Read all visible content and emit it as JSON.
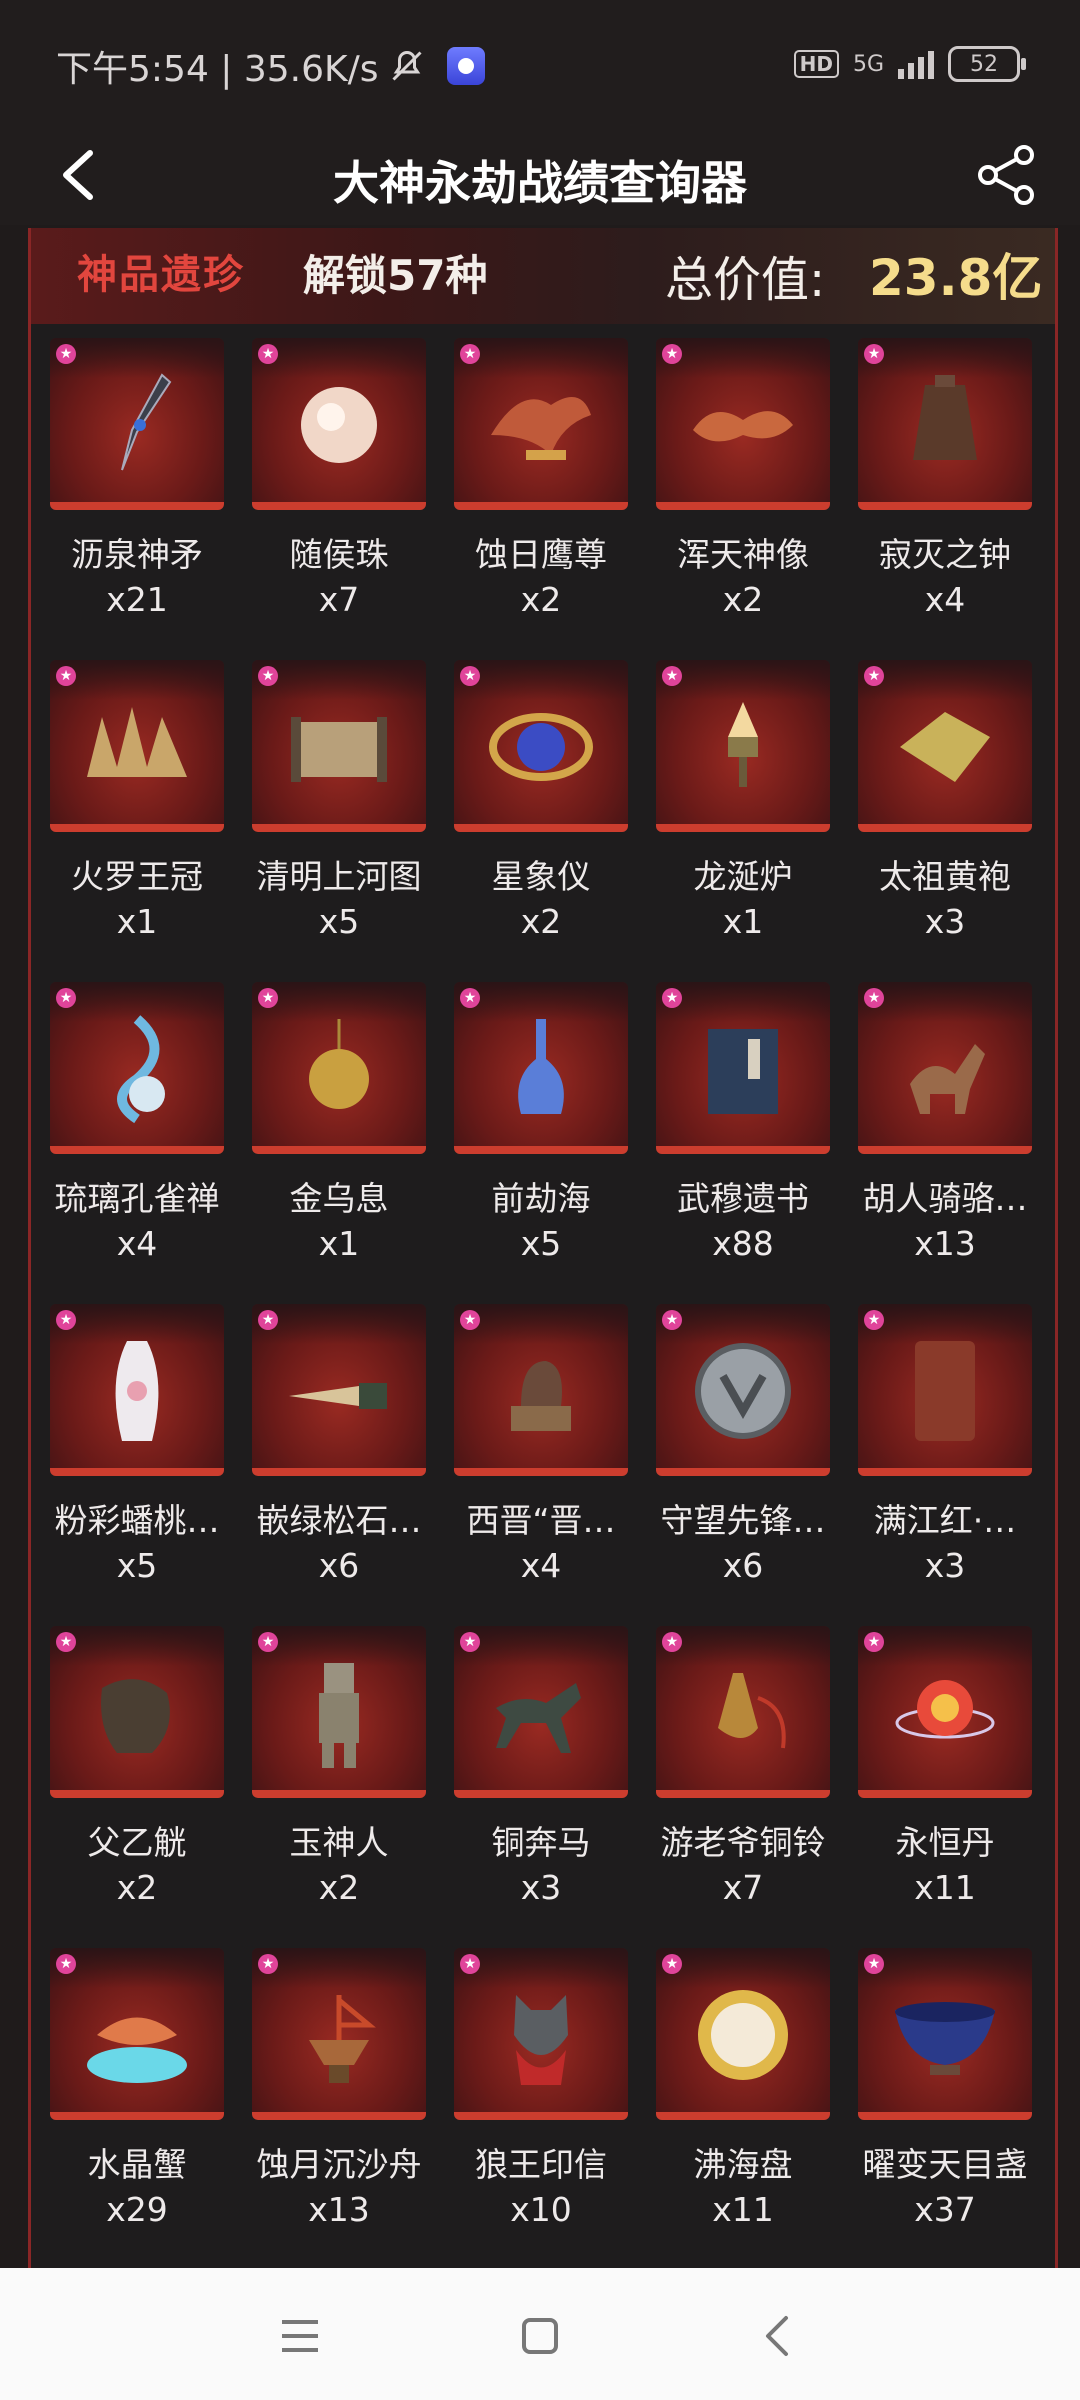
{
  "status_bar": {
    "time_speed": "下午5:54 | 35.6K/s",
    "network_hd": "HD",
    "network_gen": "5G",
    "battery": "52"
  },
  "header": {
    "title": "大神永劫战绩查询器"
  },
  "panel": {
    "tier_label": "神品遗珍",
    "unlock_text": "解锁57种",
    "total_label": "总价值:",
    "total_value": "23.8亿"
  },
  "items": [
    {
      "name": "沥泉神矛",
      "count": "x21",
      "icon": "spear-icon"
    },
    {
      "name": "随侯珠",
      "count": "x7",
      "icon": "pearl-icon"
    },
    {
      "name": "蚀日鹰尊",
      "count": "x2",
      "icon": "eagle-vessel-icon"
    },
    {
      "name": "浑天神像",
      "count": "x2",
      "icon": "dragon-statue-icon"
    },
    {
      "name": "寂灭之钟",
      "count": "x4",
      "icon": "bell-icon"
    },
    {
      "name": "火罗王冠",
      "count": "x1",
      "icon": "crown-icon"
    },
    {
      "name": "清明上河图",
      "count": "x5",
      "icon": "scroll-icon"
    },
    {
      "name": "星象仪",
      "count": "x2",
      "icon": "astrolabe-icon"
    },
    {
      "name": "龙涎炉",
      "count": "x1",
      "icon": "incense-burner-icon"
    },
    {
      "name": "太祖黄袍",
      "count": "x3",
      "icon": "robe-icon"
    },
    {
      "name": "琉璃孔雀禅",
      "count": "x4",
      "icon": "peacock-icon"
    },
    {
      "name": "金乌息",
      "count": "x1",
      "icon": "golden-censer-icon"
    },
    {
      "name": "前劫海",
      "count": "x5",
      "icon": "potion-bottle-icon"
    },
    {
      "name": "武穆遗书",
      "count": "x88",
      "icon": "book-icon"
    },
    {
      "name": "胡人骑骆…",
      "count": "x13",
      "icon": "camel-rider-icon"
    },
    {
      "name": "粉彩蟠桃…",
      "count": "x5",
      "icon": "vase-icon"
    },
    {
      "name": "嵌绿松石…",
      "count": "x6",
      "icon": "dagger-icon"
    },
    {
      "name": "西晋“晋…",
      "count": "x4",
      "icon": "seal-beast-icon"
    },
    {
      "name": "守望先锋…",
      "count": "x6",
      "icon": "shield-disc-icon"
    },
    {
      "name": "满江红·…",
      "count": "x3",
      "icon": "stone-seal-icon"
    },
    {
      "name": "父乙觥",
      "count": "x2",
      "icon": "bronze-vessel-icon"
    },
    {
      "name": "玉神人",
      "count": "x2",
      "icon": "jade-figure-icon"
    },
    {
      "name": "铜奔马",
      "count": "x3",
      "icon": "bronze-horse-icon"
    },
    {
      "name": "游老爷铜铃",
      "count": "x7",
      "icon": "bronze-bell-icon"
    },
    {
      "name": "永恒丹",
      "count": "x11",
      "icon": "elixir-orb-icon"
    },
    {
      "name": "水晶蟹",
      "count": "x29",
      "icon": "crab-icon"
    },
    {
      "name": "蚀月沉沙舟",
      "count": "x13",
      "icon": "ship-lamp-icon"
    },
    {
      "name": "狼王印信",
      "count": "x10",
      "icon": "wolf-seal-icon"
    },
    {
      "name": "沸海盘",
      "count": "x11",
      "icon": "golden-plate-icon"
    },
    {
      "name": "曜变天目盏",
      "count": "x37",
      "icon": "tea-bowl-icon"
    }
  ],
  "colors": {
    "accent_red": "#cc3d2e",
    "gold": "#f5dc8c",
    "badge_pink": "#e0449a"
  }
}
